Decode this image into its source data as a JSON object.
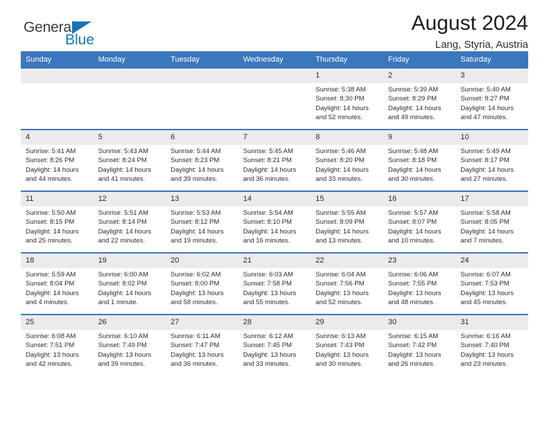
{
  "brand": {
    "name_part1": "General",
    "name_part2": "Blue",
    "triangle_icon": "triangle-icon",
    "accent_color": "#1673bf"
  },
  "header": {
    "title": "August 2024",
    "subtitle": "Lang, Styria, Austria"
  },
  "theme": {
    "header_blue": "#3b77bc",
    "date_band_gray": "#ebebeb",
    "text_color": "#2b2b2b"
  },
  "weekday_headers": [
    "Sunday",
    "Monday",
    "Tuesday",
    "Wednesday",
    "Thursday",
    "Friday",
    "Saturday"
  ],
  "weeks": [
    [
      {
        "day": "",
        "sunrise": "",
        "sunset": "",
        "daylight_line1": "",
        "daylight_line2": "",
        "empty": true
      },
      {
        "day": "",
        "sunrise": "",
        "sunset": "",
        "daylight_line1": "",
        "daylight_line2": "",
        "empty": true
      },
      {
        "day": "",
        "sunrise": "",
        "sunset": "",
        "daylight_line1": "",
        "daylight_line2": "",
        "empty": true
      },
      {
        "day": "",
        "sunrise": "",
        "sunset": "",
        "daylight_line1": "",
        "daylight_line2": "",
        "empty": true
      },
      {
        "day": "1",
        "sunrise": "Sunrise: 5:38 AM",
        "sunset": "Sunset: 8:30 PM",
        "daylight_line1": "Daylight: 14 hours",
        "daylight_line2": "and 52 minutes."
      },
      {
        "day": "2",
        "sunrise": "Sunrise: 5:39 AM",
        "sunset": "Sunset: 8:29 PM",
        "daylight_line1": "Daylight: 14 hours",
        "daylight_line2": "and 49 minutes."
      },
      {
        "day": "3",
        "sunrise": "Sunrise: 5:40 AM",
        "sunset": "Sunset: 8:27 PM",
        "daylight_line1": "Daylight: 14 hours",
        "daylight_line2": "and 47 minutes."
      }
    ],
    [
      {
        "day": "4",
        "sunrise": "Sunrise: 5:41 AM",
        "sunset": "Sunset: 8:26 PM",
        "daylight_line1": "Daylight: 14 hours",
        "daylight_line2": "and 44 minutes."
      },
      {
        "day": "5",
        "sunrise": "Sunrise: 5:43 AM",
        "sunset": "Sunset: 8:24 PM",
        "daylight_line1": "Daylight: 14 hours",
        "daylight_line2": "and 41 minutes."
      },
      {
        "day": "6",
        "sunrise": "Sunrise: 5:44 AM",
        "sunset": "Sunset: 8:23 PM",
        "daylight_line1": "Daylight: 14 hours",
        "daylight_line2": "and 39 minutes."
      },
      {
        "day": "7",
        "sunrise": "Sunrise: 5:45 AM",
        "sunset": "Sunset: 8:21 PM",
        "daylight_line1": "Daylight: 14 hours",
        "daylight_line2": "and 36 minutes."
      },
      {
        "day": "8",
        "sunrise": "Sunrise: 5:46 AM",
        "sunset": "Sunset: 8:20 PM",
        "daylight_line1": "Daylight: 14 hours",
        "daylight_line2": "and 33 minutes."
      },
      {
        "day": "9",
        "sunrise": "Sunrise: 5:48 AM",
        "sunset": "Sunset: 8:18 PM",
        "daylight_line1": "Daylight: 14 hours",
        "daylight_line2": "and 30 minutes."
      },
      {
        "day": "10",
        "sunrise": "Sunrise: 5:49 AM",
        "sunset": "Sunset: 8:17 PM",
        "daylight_line1": "Daylight: 14 hours",
        "daylight_line2": "and 27 minutes."
      }
    ],
    [
      {
        "day": "11",
        "sunrise": "Sunrise: 5:50 AM",
        "sunset": "Sunset: 8:15 PM",
        "daylight_line1": "Daylight: 14 hours",
        "daylight_line2": "and 25 minutes."
      },
      {
        "day": "12",
        "sunrise": "Sunrise: 5:51 AM",
        "sunset": "Sunset: 8:14 PM",
        "daylight_line1": "Daylight: 14 hours",
        "daylight_line2": "and 22 minutes."
      },
      {
        "day": "13",
        "sunrise": "Sunrise: 5:53 AM",
        "sunset": "Sunset: 8:12 PM",
        "daylight_line1": "Daylight: 14 hours",
        "daylight_line2": "and 19 minutes."
      },
      {
        "day": "14",
        "sunrise": "Sunrise: 5:54 AM",
        "sunset": "Sunset: 8:10 PM",
        "daylight_line1": "Daylight: 14 hours",
        "daylight_line2": "and 16 minutes."
      },
      {
        "day": "15",
        "sunrise": "Sunrise: 5:55 AM",
        "sunset": "Sunset: 8:09 PM",
        "daylight_line1": "Daylight: 14 hours",
        "daylight_line2": "and 13 minutes."
      },
      {
        "day": "16",
        "sunrise": "Sunrise: 5:57 AM",
        "sunset": "Sunset: 8:07 PM",
        "daylight_line1": "Daylight: 14 hours",
        "daylight_line2": "and 10 minutes."
      },
      {
        "day": "17",
        "sunrise": "Sunrise: 5:58 AM",
        "sunset": "Sunset: 8:05 PM",
        "daylight_line1": "Daylight: 14 hours",
        "daylight_line2": "and 7 minutes."
      }
    ],
    [
      {
        "day": "18",
        "sunrise": "Sunrise: 5:59 AM",
        "sunset": "Sunset: 8:04 PM",
        "daylight_line1": "Daylight: 14 hours",
        "daylight_line2": "and 4 minutes."
      },
      {
        "day": "19",
        "sunrise": "Sunrise: 6:00 AM",
        "sunset": "Sunset: 8:02 PM",
        "daylight_line1": "Daylight: 14 hours",
        "daylight_line2": "and 1 minute."
      },
      {
        "day": "20",
        "sunrise": "Sunrise: 6:02 AM",
        "sunset": "Sunset: 8:00 PM",
        "daylight_line1": "Daylight: 13 hours",
        "daylight_line2": "and 58 minutes."
      },
      {
        "day": "21",
        "sunrise": "Sunrise: 6:03 AM",
        "sunset": "Sunset: 7:58 PM",
        "daylight_line1": "Daylight: 13 hours",
        "daylight_line2": "and 55 minutes."
      },
      {
        "day": "22",
        "sunrise": "Sunrise: 6:04 AM",
        "sunset": "Sunset: 7:56 PM",
        "daylight_line1": "Daylight: 13 hours",
        "daylight_line2": "and 52 minutes."
      },
      {
        "day": "23",
        "sunrise": "Sunrise: 6:06 AM",
        "sunset": "Sunset: 7:55 PM",
        "daylight_line1": "Daylight: 13 hours",
        "daylight_line2": "and 48 minutes."
      },
      {
        "day": "24",
        "sunrise": "Sunrise: 6:07 AM",
        "sunset": "Sunset: 7:53 PM",
        "daylight_line1": "Daylight: 13 hours",
        "daylight_line2": "and 45 minutes."
      }
    ],
    [
      {
        "day": "25",
        "sunrise": "Sunrise: 6:08 AM",
        "sunset": "Sunset: 7:51 PM",
        "daylight_line1": "Daylight: 13 hours",
        "daylight_line2": "and 42 minutes."
      },
      {
        "day": "26",
        "sunrise": "Sunrise: 6:10 AM",
        "sunset": "Sunset: 7:49 PM",
        "daylight_line1": "Daylight: 13 hours",
        "daylight_line2": "and 39 minutes."
      },
      {
        "day": "27",
        "sunrise": "Sunrise: 6:11 AM",
        "sunset": "Sunset: 7:47 PM",
        "daylight_line1": "Daylight: 13 hours",
        "daylight_line2": "and 36 minutes."
      },
      {
        "day": "28",
        "sunrise": "Sunrise: 6:12 AM",
        "sunset": "Sunset: 7:45 PM",
        "daylight_line1": "Daylight: 13 hours",
        "daylight_line2": "and 33 minutes."
      },
      {
        "day": "29",
        "sunrise": "Sunrise: 6:13 AM",
        "sunset": "Sunset: 7:43 PM",
        "daylight_line1": "Daylight: 13 hours",
        "daylight_line2": "and 30 minutes."
      },
      {
        "day": "30",
        "sunrise": "Sunrise: 6:15 AM",
        "sunset": "Sunset: 7:42 PM",
        "daylight_line1": "Daylight: 13 hours",
        "daylight_line2": "and 26 minutes."
      },
      {
        "day": "31",
        "sunrise": "Sunrise: 6:16 AM",
        "sunset": "Sunset: 7:40 PM",
        "daylight_line1": "Daylight: 13 hours",
        "daylight_line2": "and 23 minutes."
      }
    ]
  ]
}
